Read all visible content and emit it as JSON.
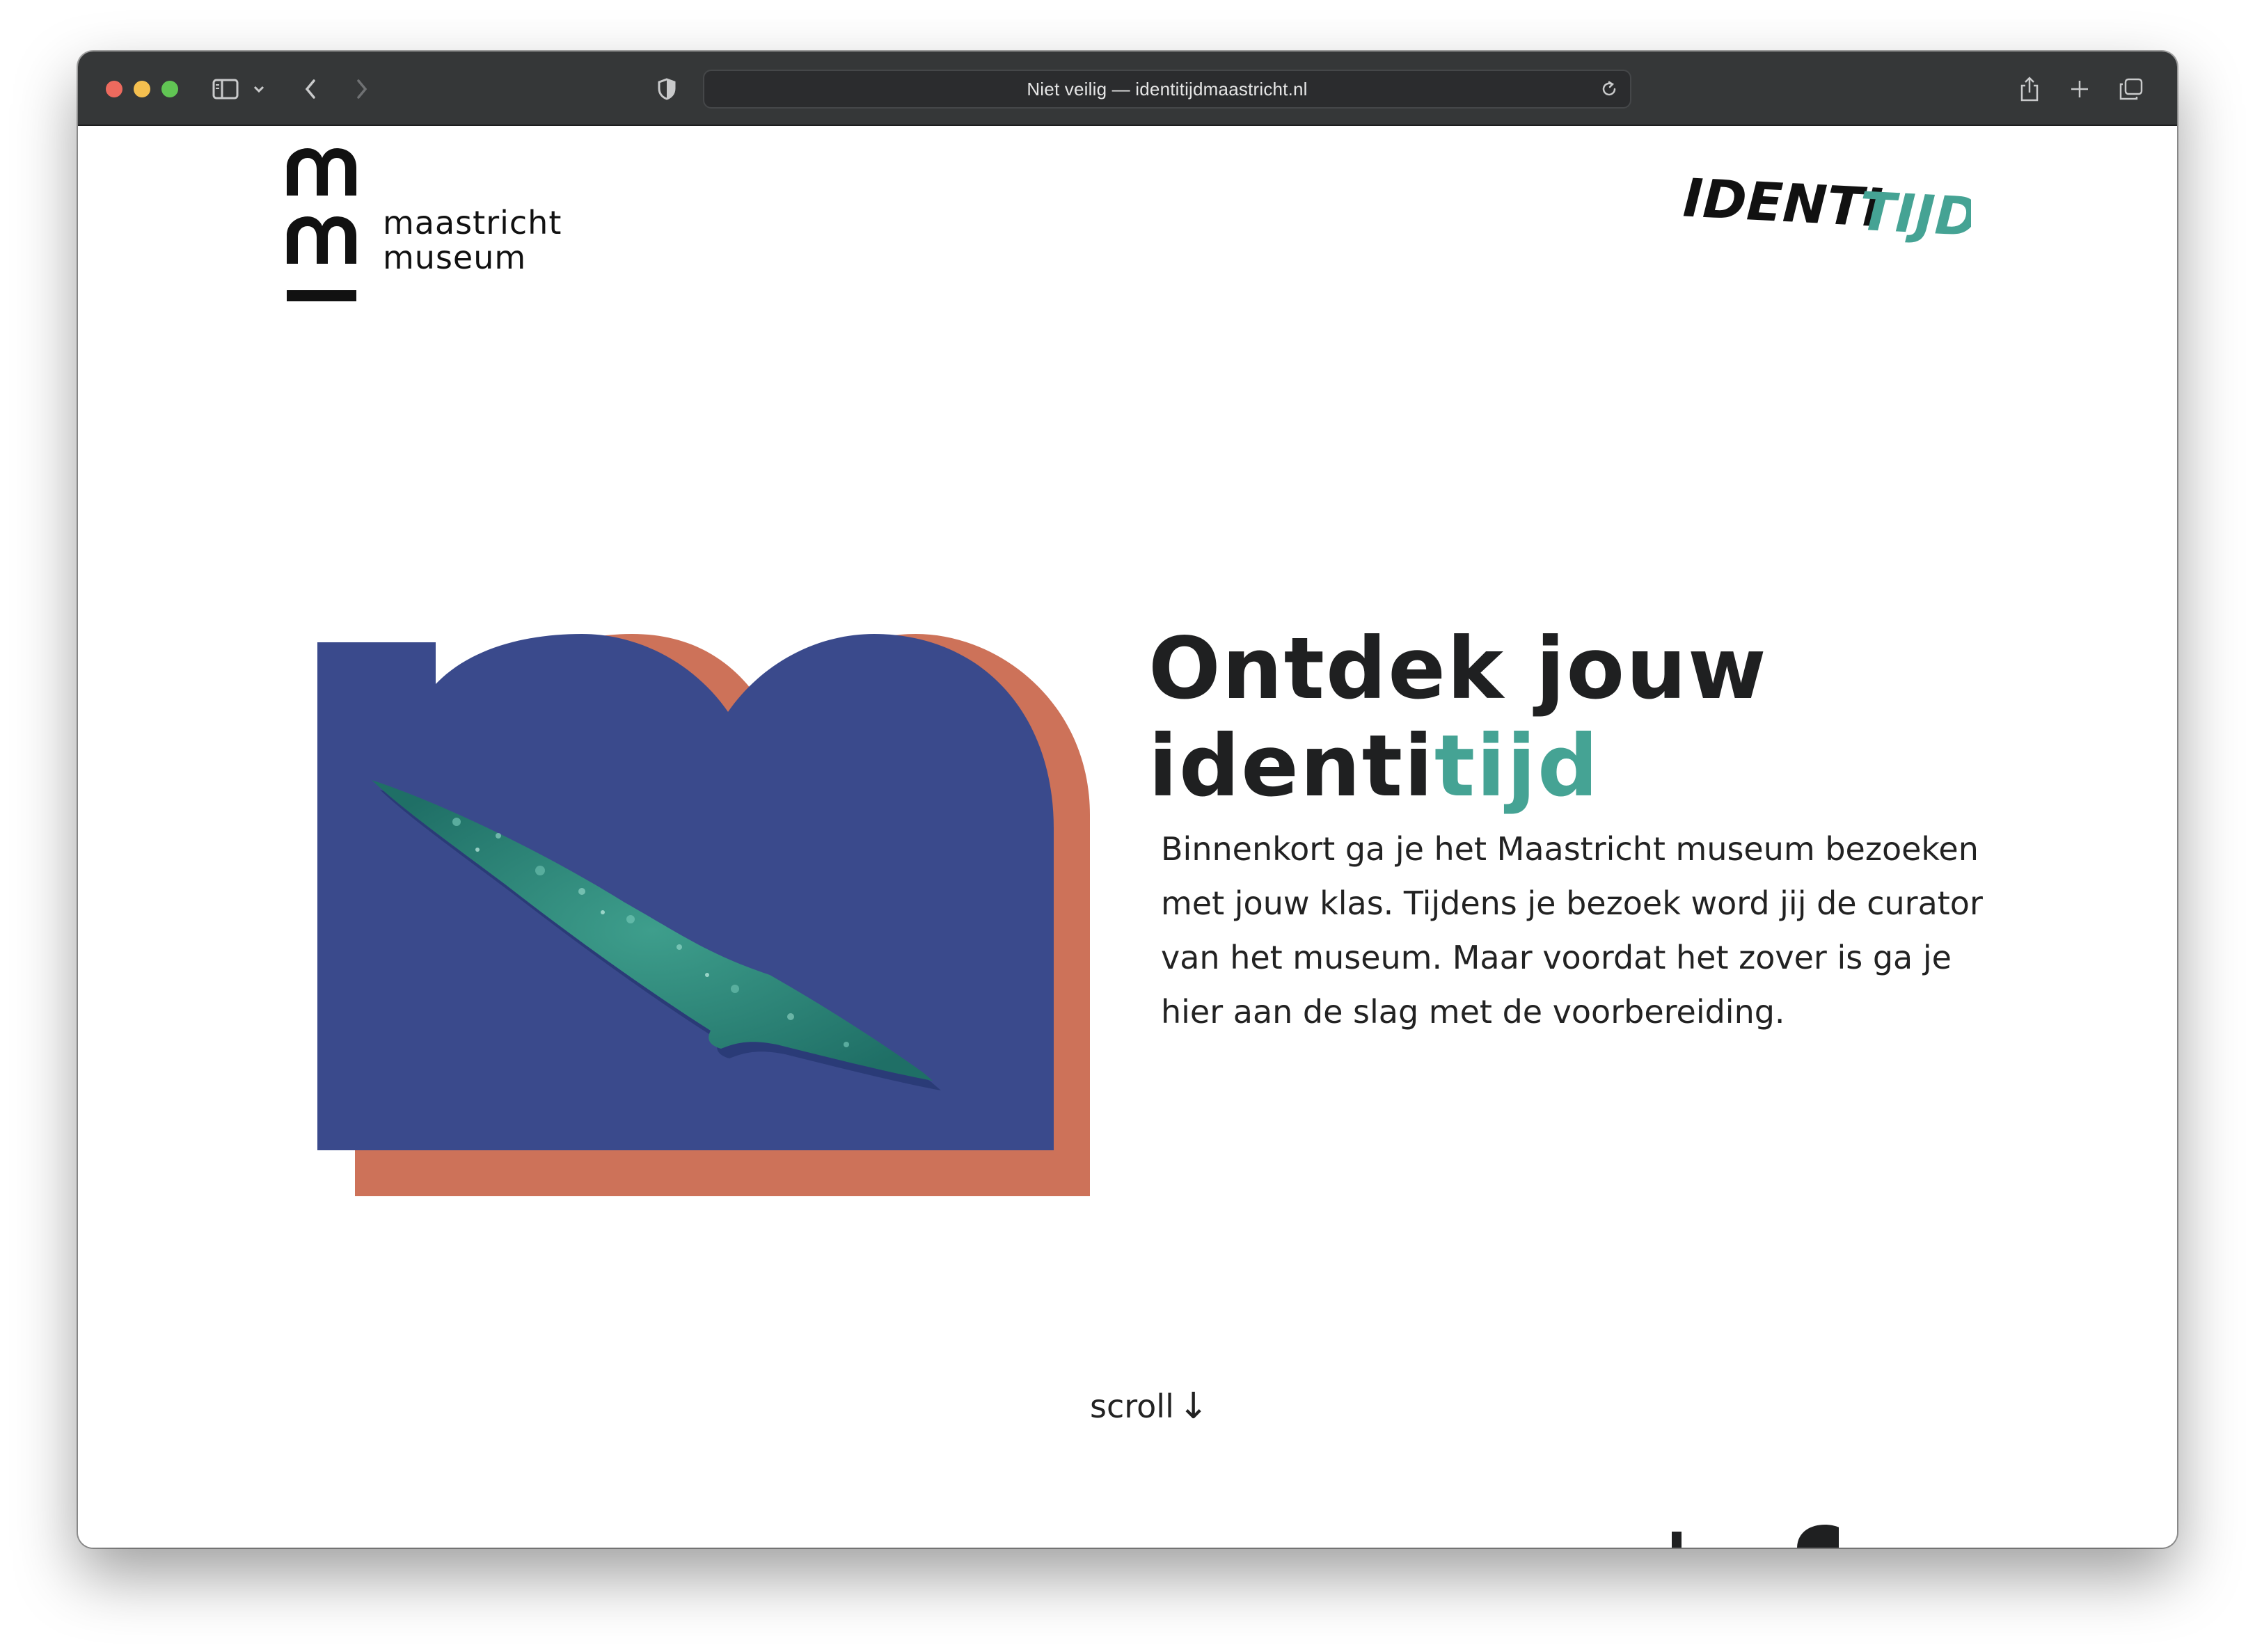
{
  "browser": {
    "url_display": "Niet veilig — identitijdmaastricht.nl"
  },
  "header": {
    "logo_line1": "maastricht",
    "logo_line2": "museum",
    "brand_main": "IDENTI",
    "brand_accent": "TIJD"
  },
  "hero": {
    "headline_line1": "Ontdek jouw",
    "headline_line2_start": "identi",
    "headline_line2_accent": "tijd",
    "intro": "Binnenkort ga je het Maastricht museum bezoeken met jouw klas. Tijdens je bezoek word jij de curator van het museum. Maar voordat het zover is ga je hier aan de slag met de voorbereiding."
  },
  "footer": {
    "scroll_label": "scroll",
    "scroll_arrow": "↓"
  },
  "colors": {
    "toolbar": "#353738",
    "accent_teal": "#45a394",
    "blue_shape": "#3a4a8c",
    "terracotta_shape": "#cd7259",
    "artifact_green": "#2f8a7a"
  },
  "icons": {
    "sidebar": "sidebar-icon",
    "back": "chevron-left-icon",
    "forward": "chevron-right-icon",
    "privacy": "shield-icon",
    "reload": "reload-icon",
    "share": "share-icon",
    "new_tab": "plus-icon",
    "tab_overview": "tabs-icon"
  }
}
